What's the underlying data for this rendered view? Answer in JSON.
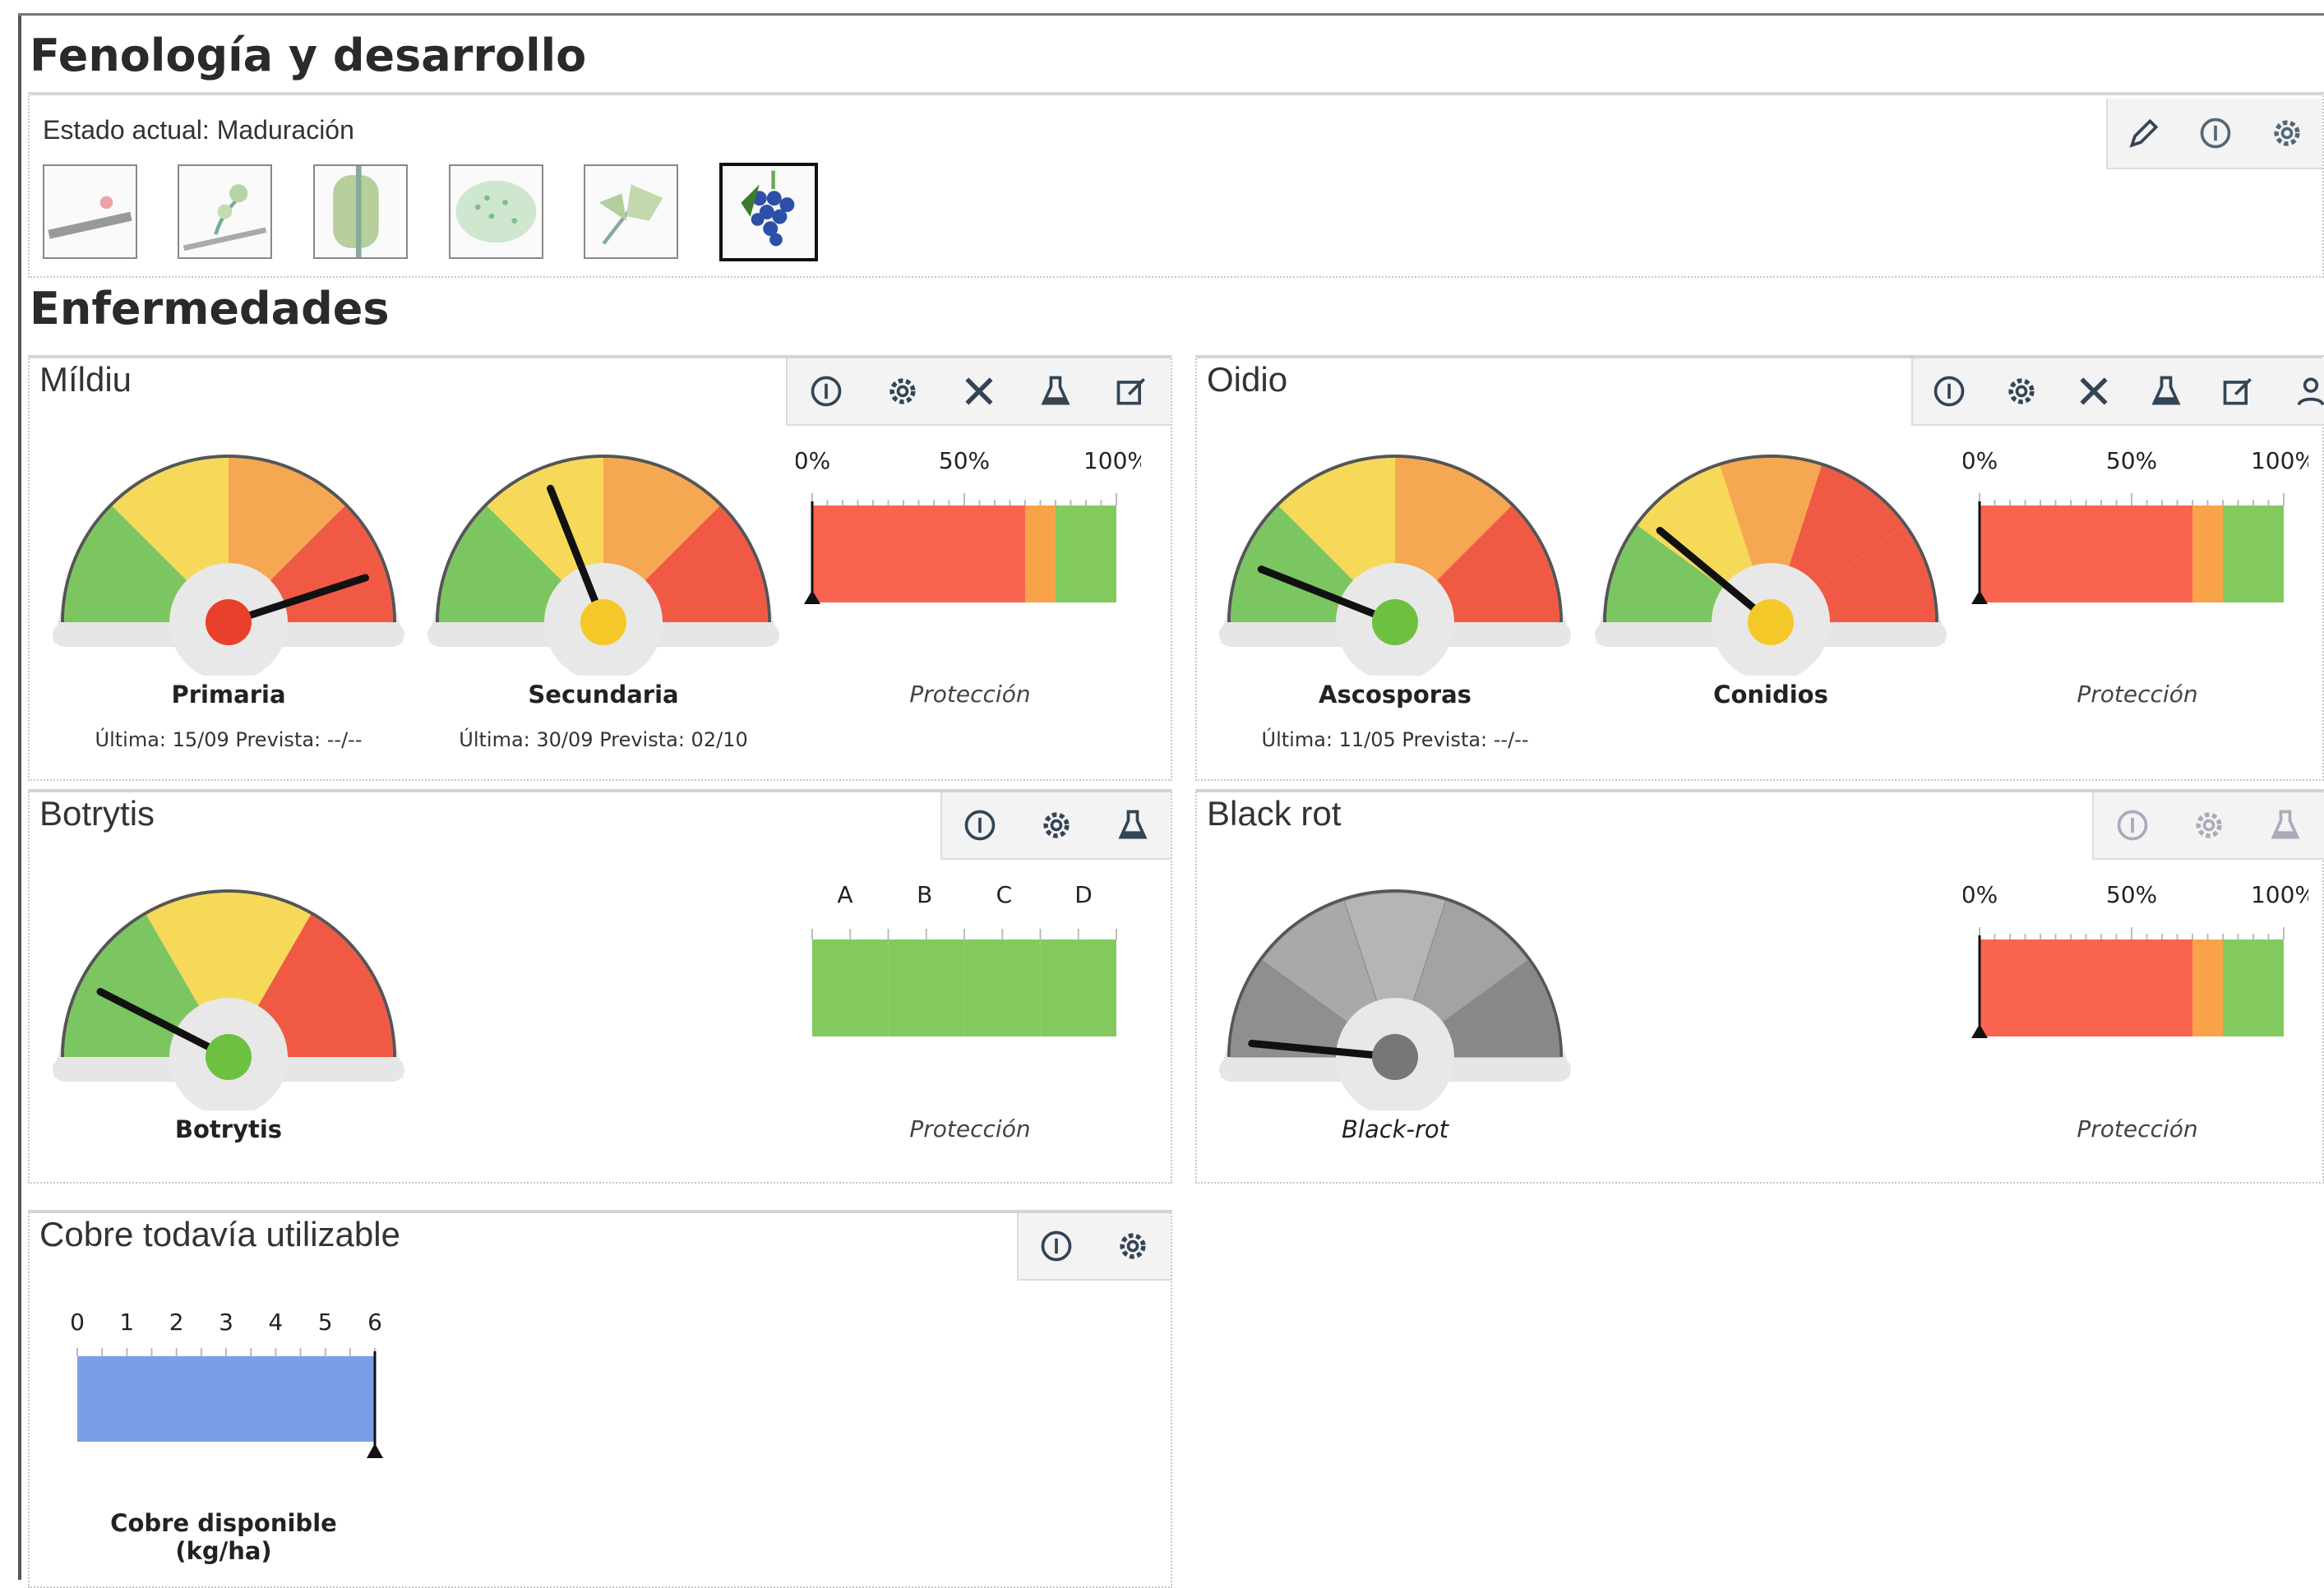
{
  "fenologia": {
    "title": "Fenología y desarrollo",
    "estado_actual": "Estado actual: Maduración",
    "stages": [
      "stage-1",
      "stage-2",
      "stage-3",
      "stage-4",
      "stage-5",
      "stage-6"
    ],
    "active_stage": 6,
    "toolbar": [
      "pencil-icon",
      "info-icon",
      "gear-icon"
    ]
  },
  "enfermedades": {
    "title": "Enfermedades"
  },
  "mildiu": {
    "title": "Míldiu",
    "toolbar": [
      "info-icon",
      "gear-icon",
      "tools-icon",
      "flask-icon",
      "edit-icon"
    ],
    "gauges": [
      {
        "label": "Primaria",
        "sub": "Última: 15/09 Prevista: --/--",
        "level": 0.9,
        "dot": "#e8402a"
      },
      {
        "label": "Secundaria",
        "sub": "Última: 30/09 Prevista: 02/10",
        "level": 0.38,
        "dot": "#f5c829"
      }
    ],
    "bar": {
      "ticks": [
        "0%",
        "50%",
        "100%"
      ],
      "caption": "Protección",
      "segments": [
        0.7,
        0.1,
        0.2
      ]
    }
  },
  "oidio": {
    "title": "Oidio",
    "toolbar": [
      "info-icon",
      "gear-icon",
      "tools-icon",
      "flask-icon",
      "edit-icon",
      "user-icon"
    ],
    "gauges": [
      {
        "label": "Ascosporas",
        "sub": "Última: 11/05 Prevista: --/--",
        "level": 0.12,
        "dot": "#6ec040"
      },
      {
        "label": "Conidios",
        "sub": "",
        "level": 0.22,
        "dot": "#f5c829"
      }
    ],
    "bar": {
      "ticks": [
        "0%",
        "50%",
        "100%"
      ],
      "caption": "Protección",
      "segments": [
        0.7,
        0.1,
        0.2
      ]
    }
  },
  "botrytis": {
    "title": "Botrytis",
    "toolbar": [
      "info-icon",
      "gear-icon",
      "flask-icon"
    ],
    "gauge": {
      "label": "Botrytis",
      "level": 0.15,
      "dot": "#6ec040"
    },
    "bar": {
      "ticks": [
        "A",
        "B",
        "C",
        "D"
      ],
      "caption": "Protección"
    }
  },
  "blackrot": {
    "title": "Black rot",
    "toolbar": [
      "info-icon",
      "gear-icon",
      "flask-icon"
    ],
    "gauge": {
      "label": "Black-rot",
      "level": 0.03,
      "dot": "#777777"
    },
    "bar": {
      "ticks": [
        "0%",
        "50%",
        "100%"
      ],
      "caption": "Protección",
      "segments": [
        0.7,
        0.1,
        0.2
      ]
    }
  },
  "cobre": {
    "title": "Cobre todavía utilizable",
    "toolbar": [
      "info-icon",
      "gear-icon"
    ],
    "ticks": [
      "0",
      "1",
      "2",
      "3",
      "4",
      "5",
      "6"
    ],
    "value": 6,
    "max": 6,
    "caption_line1": "Cobre disponible",
    "caption_line2": "(kg/ha)"
  },
  "colors": {
    "green": "#7cc661",
    "yellow": "#f7d95a",
    "orange": "#f5a851",
    "red": "#f05a45",
    "bar_red": "#f96450",
    "bar_orange": "#f8a34a",
    "bar_green": "#82c95e",
    "blue": "#7b9fe6"
  }
}
